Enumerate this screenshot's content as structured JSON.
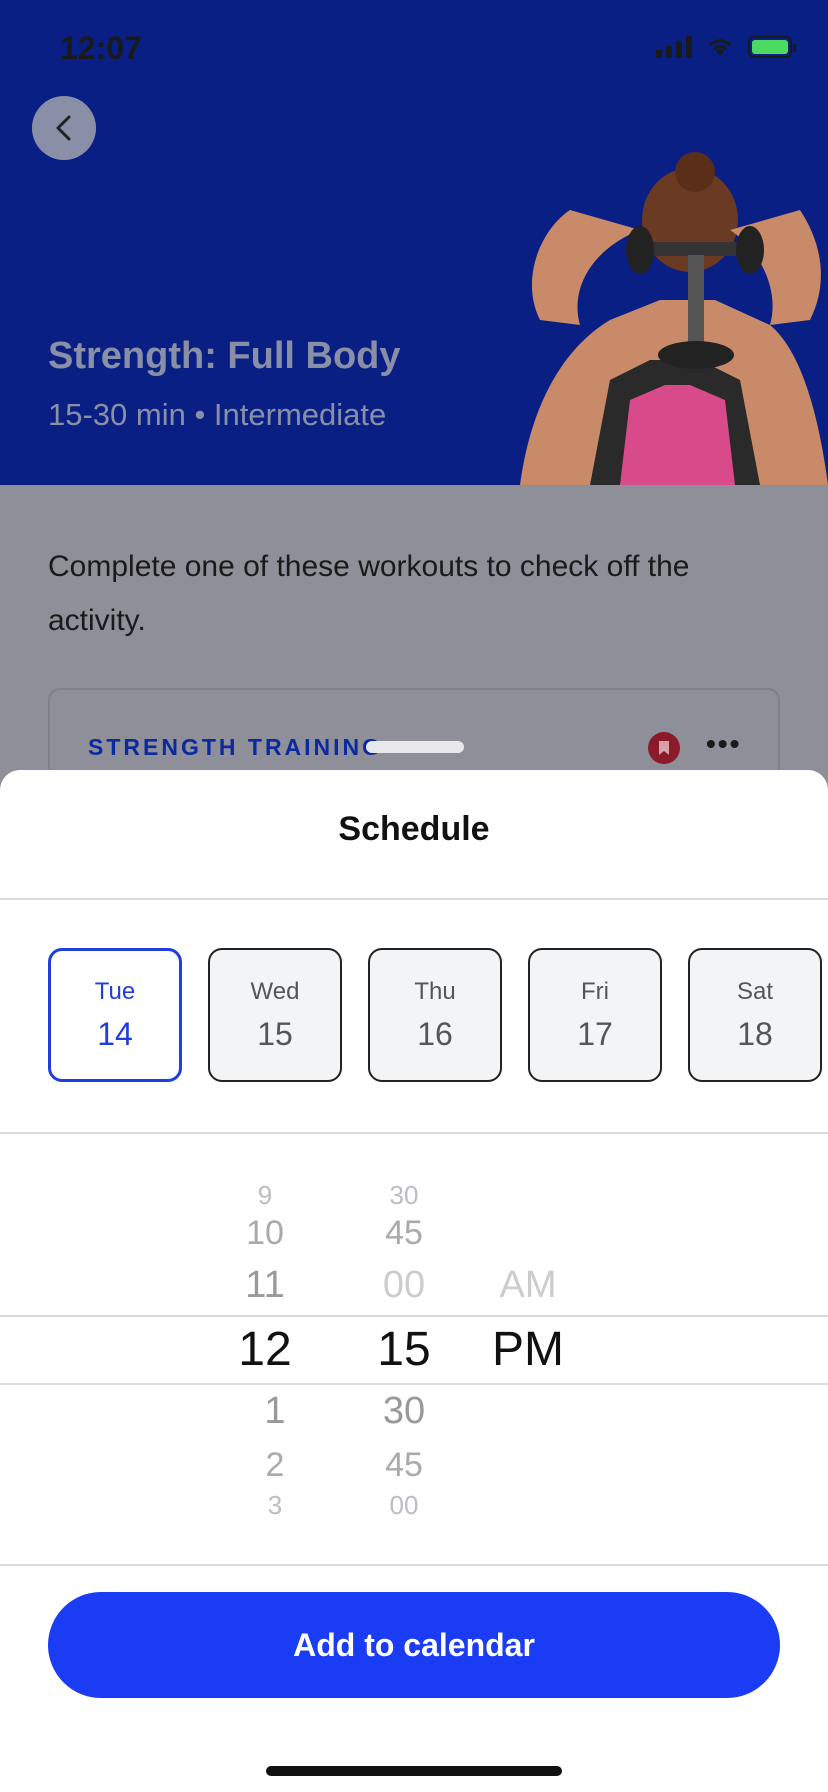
{
  "status_bar": {
    "time": "12:07"
  },
  "hero": {
    "title": "Strength: Full Body",
    "subtitle": "15-30 min • Intermediate"
  },
  "body": {
    "intro": "Complete one of these workouts to check off the activity.",
    "card_label": "STRENGTH TRAINING",
    "more": "•••"
  },
  "sheet": {
    "title": "Schedule",
    "days": [
      {
        "name": "Tue",
        "num": "14",
        "selected": true
      },
      {
        "name": "Wed",
        "num": "15",
        "selected": false
      },
      {
        "name": "Thu",
        "num": "16",
        "selected": false
      },
      {
        "name": "Fri",
        "num": "17",
        "selected": false
      },
      {
        "name": "Sat",
        "num": "18",
        "selected": false
      }
    ],
    "picker": {
      "hours": [
        "9",
        "10",
        "11",
        "12",
        "1",
        "2",
        "3"
      ],
      "minutes": [
        "30",
        "45",
        "00",
        "15",
        "30",
        "45",
        "00"
      ],
      "ampm_above": "AM",
      "ampm_selected": "PM"
    },
    "add_button": "Add to calendar"
  },
  "colors": {
    "accent": "#1a3cf5",
    "hero_bg": "#0a1f84",
    "selected_day": "#1f3ee0"
  }
}
